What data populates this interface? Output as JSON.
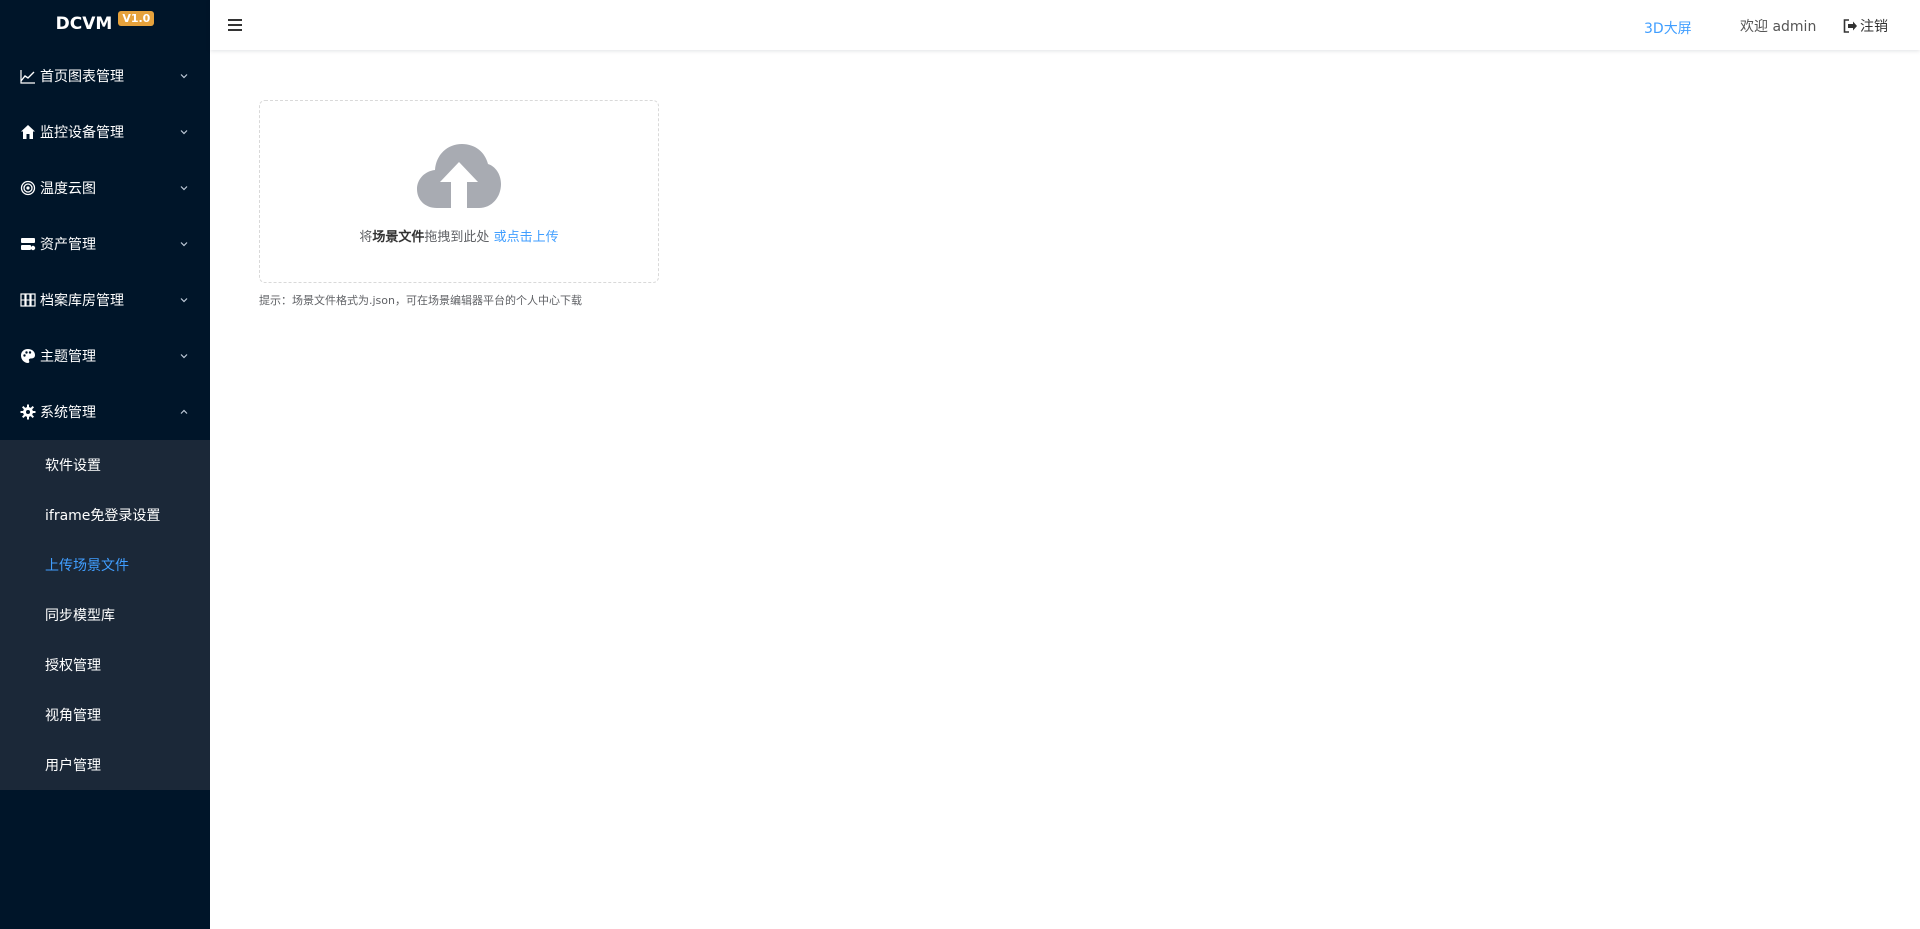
{
  "app": {
    "name": "DCVM",
    "version": "V1.0"
  },
  "sidebar": {
    "menu": [
      {
        "label": "首页图表管理",
        "icon": "chart-line-icon"
      },
      {
        "label": "监控设备管理",
        "icon": "home-icon"
      },
      {
        "label": "温度云图",
        "icon": "target-icon"
      },
      {
        "label": "资产管理",
        "icon": "server-icon"
      },
      {
        "label": "档案库房管理",
        "icon": "archive-shelf-icon"
      },
      {
        "label": "主题管理",
        "icon": "palette-icon"
      },
      {
        "label": "系统管理",
        "icon": "gear-icon"
      }
    ],
    "submenu": [
      {
        "label": "软件设置"
      },
      {
        "label": "iframe免登录设置"
      },
      {
        "label": "上传场景文件"
      },
      {
        "label": "同步模型库"
      },
      {
        "label": "授权管理"
      },
      {
        "label": "视角管理"
      },
      {
        "label": "用户管理"
      }
    ]
  },
  "header": {
    "link_3d": "3D大屏",
    "welcome": "欢迎 admin",
    "logout": "注销"
  },
  "upload": {
    "text_prefix": "将",
    "text_bold": "场景文件",
    "text_middle": "拖拽到此处",
    "text_link": "或点击上传",
    "tip": "提示：场景文件格式为.json，可在场景编辑器平台的个人中心下载"
  },
  "colors": {
    "sidebar_bg": "#001529",
    "submenu_bg": "#1b2838",
    "accent": "#409eff",
    "version_badge": "#e6a23c"
  }
}
